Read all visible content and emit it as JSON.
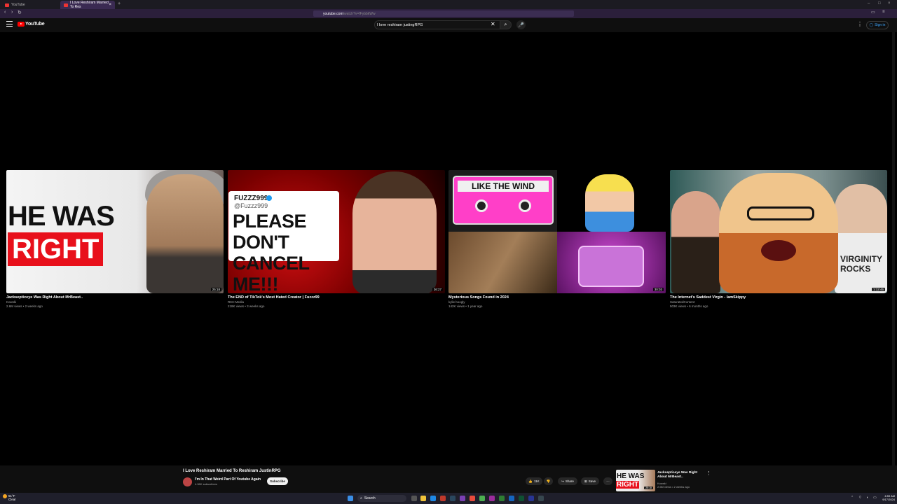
{
  "browser": {
    "tabs": [
      {
        "label": "YouTube"
      },
      {
        "label": "I Love Reshiram Married To Res"
      }
    ],
    "url_host": "youtube.com",
    "url_path": "/watch?v=fFybbkWw"
  },
  "header": {
    "logo_text": "YouTube",
    "search_value": "I love reshiram justingRPG",
    "sign_in_label": "Sign in"
  },
  "videos": [
    {
      "title": "Jacksepticeye Was Right About MrBeast..",
      "channel": "Kowski",
      "meta": "2.6M views • 2 weeks ago",
      "duration": "25:18",
      "thumb_text_1": "HE WAS",
      "thumb_text_2": "RIGHT"
    },
    {
      "title": "The END of TikTok's Most Hated Creator | Fuzzz99",
      "channel": "RKH Media",
      "meta": "218K views • 3 weeks ago",
      "duration": "26:27",
      "thumb_handle": "FUZZZ999",
      "thumb_at": "@Fuzzz999",
      "thumb_text": "PLEASE DON'T CANCEL ME!!!"
    },
    {
      "title": "Mysterious Songs Found in 2024",
      "channel": "kylie boogly",
      "meta": "142K views • 1 year ago",
      "duration": "30:03",
      "thumb_text": "LIKE THE WIND"
    },
    {
      "title": "The Internet's Saddest Virgin - IamSkippy",
      "channel": "SaturatedContent",
      "meta": "503K views • 6 months ago",
      "duration": "1:12:46",
      "thumb_text": "VIRGINITY ROCKS"
    }
  ],
  "miniplayer": {
    "title": "I Love Reshiram Married To Reshiram JustinRPG",
    "channel": "I'm In That Weird Part Of Youtube Again",
    "subscribers": "4.96K subscribers",
    "subscribe_label": "Subscribe",
    "like_count": "11K",
    "share_label": "Share",
    "save_label": "Save",
    "next_title": "Jacksepticeye Was Right About MrBeast..",
    "next_channel": "Kowski",
    "next_meta": "2.6M views • 2 weeks ago",
    "next_duration": "25:18",
    "next_thumb_1": "HE WAS",
    "next_thumb_2": "RIGHT"
  },
  "taskbar": {
    "temp": "51°F",
    "weather": "Clear",
    "search_label": "Search",
    "time": "4:59 AM",
    "date": "9/17/2024"
  },
  "colors": {
    "brand_red": "#ff0000",
    "link_blue": "#3ea6ff",
    "background": "#000000"
  }
}
